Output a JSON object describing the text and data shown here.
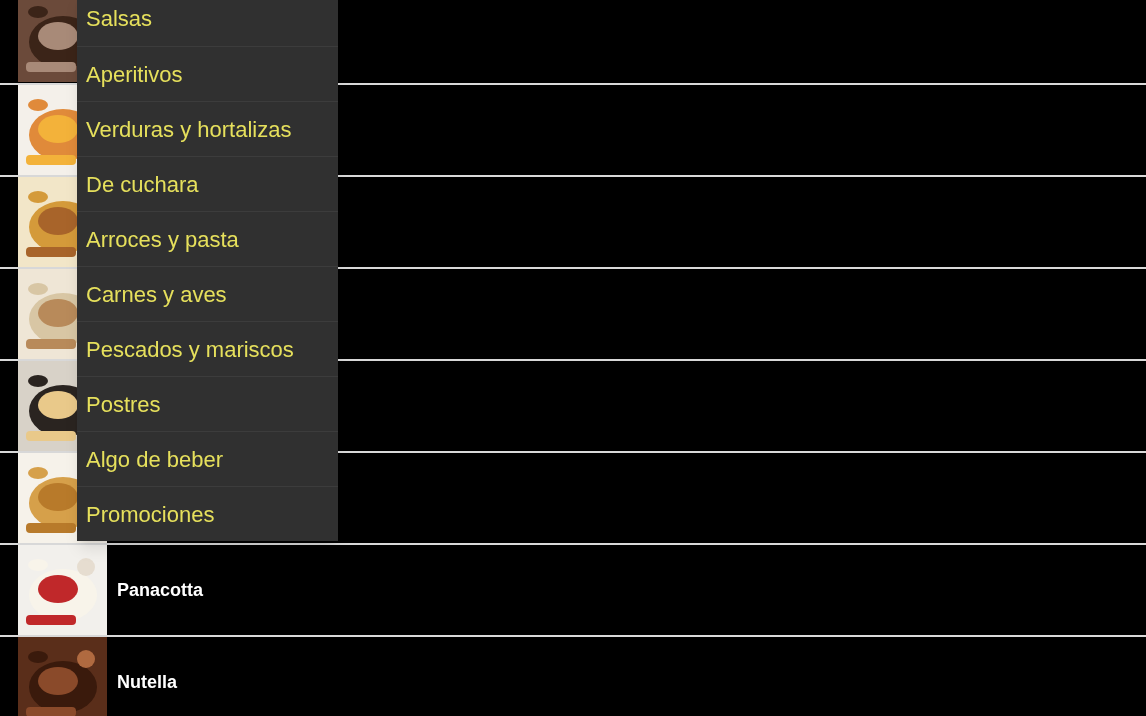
{
  "list": {
    "rows": [
      {
        "thumbnail": {
          "kind": "picture"
        }
      },
      {
        "thumbnail": {
          "kind": "picture"
        }
      },
      {
        "thumbnail": {
          "kind": "picture"
        }
      },
      {
        "thumbnail": {
          "kind": "picture"
        }
      },
      {
        "thumbnail": {
          "kind": "picture"
        }
      },
      {
        "thumbnail": {
          "kind": "picture"
        }
      },
      {
        "thumbnail": {
          "kind": "picture"
        },
        "title": "Panacotta"
      },
      {
        "thumbnail": {
          "kind": "picture"
        },
        "title": "Nutella"
      }
    ]
  },
  "menu": {
    "items": [
      {
        "label": "Salsas"
      },
      {
        "label": "Aperitivos"
      },
      {
        "label": "Verduras y hortalizas"
      },
      {
        "label": "De cuchara"
      },
      {
        "label": "Arroces y pasta"
      },
      {
        "label": "Carnes y aves"
      },
      {
        "label": "Pescados y mariscos"
      },
      {
        "label": "Postres"
      },
      {
        "label": "Algo de beber"
      },
      {
        "label": "Promociones"
      }
    ]
  }
}
